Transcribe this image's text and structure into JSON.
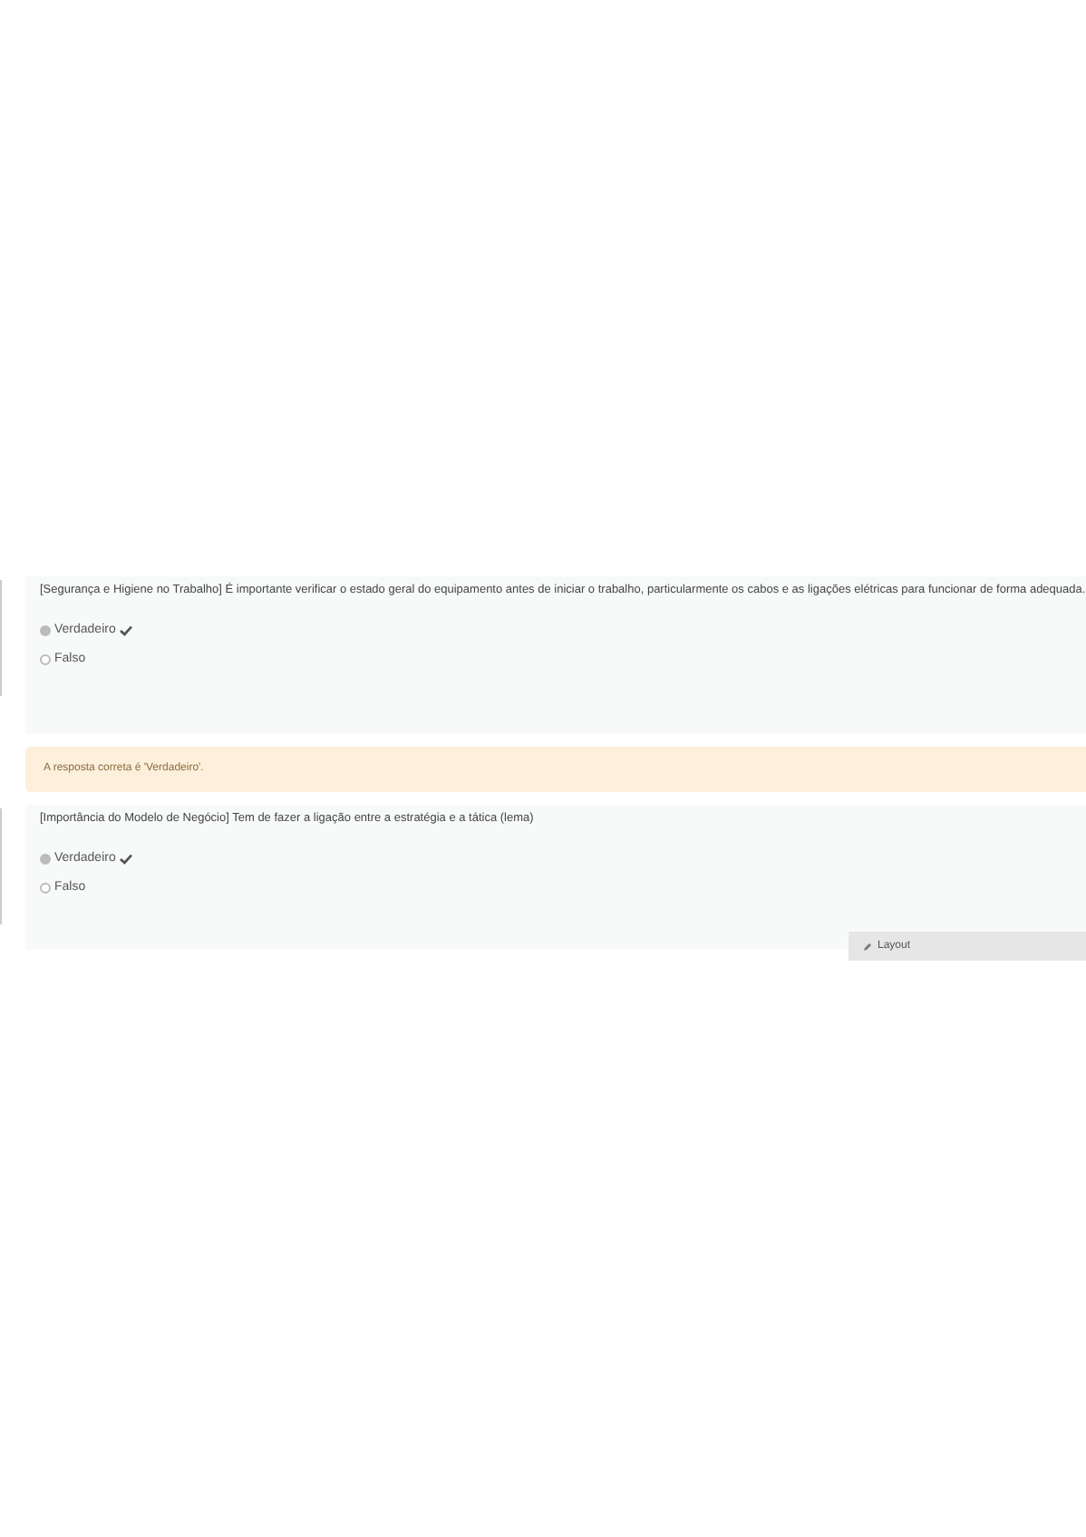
{
  "questions": [
    {
      "text": "[Segurança e Higiene no Trabalho] É importante verificar o estado geral do equipamento antes de iniciar o trabalho, particularmente os cabos e as ligações elétricas para funcionar de forma adequada.",
      "options": [
        {
          "label": "Verdadeiro",
          "selected": true,
          "correct": true
        },
        {
          "label": "Falso",
          "selected": false,
          "correct": false
        }
      ],
      "feedback": "A resposta correta é 'Verdadeiro'."
    },
    {
      "text": "[Importância do Modelo de Negócio] Tem de fazer a ligação entre a estratégia e a tática (lema)",
      "options": [
        {
          "label": "Verdadeiro",
          "selected": true,
          "correct": true
        },
        {
          "label": "Falso",
          "selected": false,
          "correct": false
        }
      ]
    }
  ],
  "panel": {
    "label": "Layout"
  }
}
